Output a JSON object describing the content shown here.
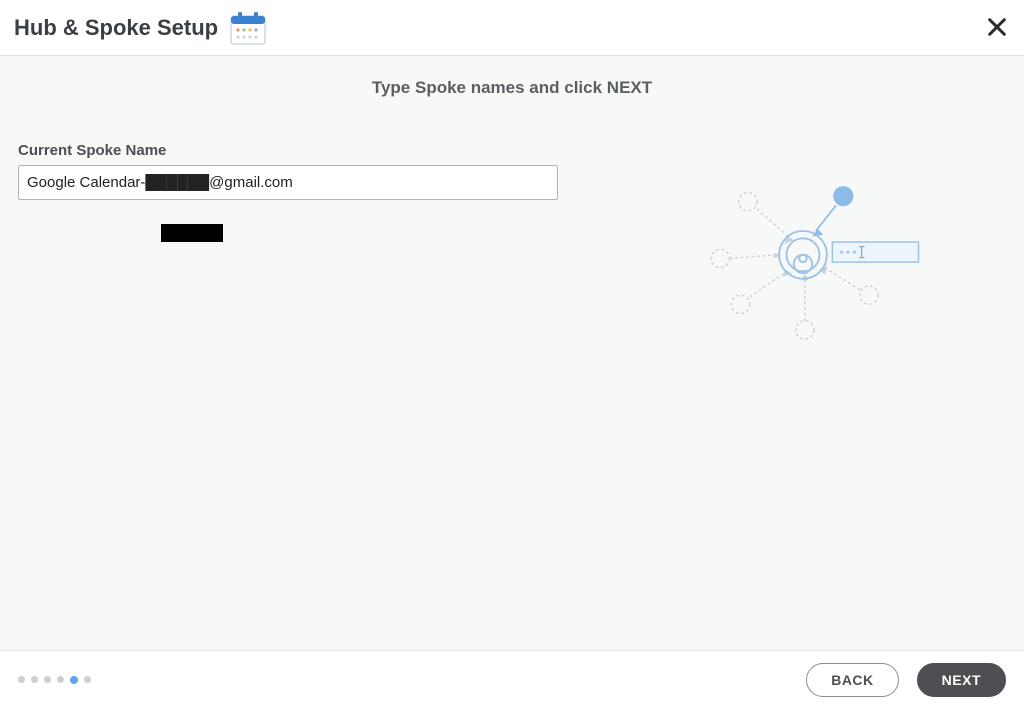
{
  "header": {
    "title": "Hub & Spoke Setup"
  },
  "instructions": "Type Spoke names and click NEXT",
  "form": {
    "spoke_name_label": "Current Spoke Name",
    "spoke_name_value": "Google Calendar-██████@gmail.com"
  },
  "footer": {
    "steps_total": 6,
    "step_active_index": 4,
    "back_label": "BACK",
    "next_label": "NEXT"
  },
  "colors": {
    "accent": "#5aa6e6",
    "button_dark": "#4d4f52",
    "diagram_blue": "#9cc2e8"
  }
}
